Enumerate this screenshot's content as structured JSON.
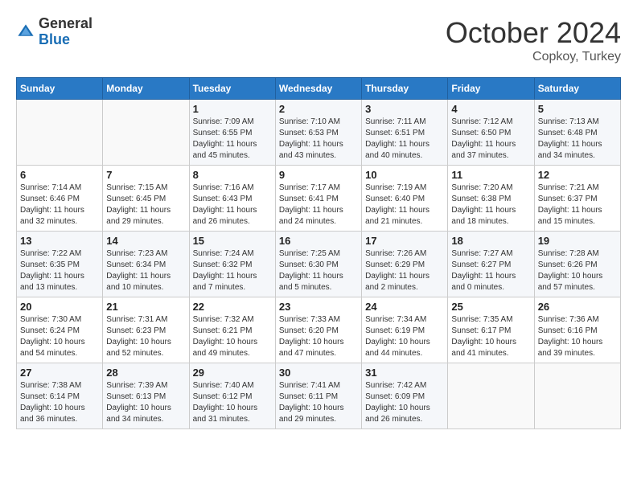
{
  "logo": {
    "general": "General",
    "blue": "Blue"
  },
  "header": {
    "month": "October 2024",
    "location": "Copkoy, Turkey"
  },
  "days_of_week": [
    "Sunday",
    "Monday",
    "Tuesday",
    "Wednesday",
    "Thursday",
    "Friday",
    "Saturday"
  ],
  "weeks": [
    [
      {
        "day": "",
        "info": ""
      },
      {
        "day": "",
        "info": ""
      },
      {
        "day": "1",
        "info": "Sunrise: 7:09 AM\nSunset: 6:55 PM\nDaylight: 11 hours and 45 minutes."
      },
      {
        "day": "2",
        "info": "Sunrise: 7:10 AM\nSunset: 6:53 PM\nDaylight: 11 hours and 43 minutes."
      },
      {
        "day": "3",
        "info": "Sunrise: 7:11 AM\nSunset: 6:51 PM\nDaylight: 11 hours and 40 minutes."
      },
      {
        "day": "4",
        "info": "Sunrise: 7:12 AM\nSunset: 6:50 PM\nDaylight: 11 hours and 37 minutes."
      },
      {
        "day": "5",
        "info": "Sunrise: 7:13 AM\nSunset: 6:48 PM\nDaylight: 11 hours and 34 minutes."
      }
    ],
    [
      {
        "day": "6",
        "info": "Sunrise: 7:14 AM\nSunset: 6:46 PM\nDaylight: 11 hours and 32 minutes."
      },
      {
        "day": "7",
        "info": "Sunrise: 7:15 AM\nSunset: 6:45 PM\nDaylight: 11 hours and 29 minutes."
      },
      {
        "day": "8",
        "info": "Sunrise: 7:16 AM\nSunset: 6:43 PM\nDaylight: 11 hours and 26 minutes."
      },
      {
        "day": "9",
        "info": "Sunrise: 7:17 AM\nSunset: 6:41 PM\nDaylight: 11 hours and 24 minutes."
      },
      {
        "day": "10",
        "info": "Sunrise: 7:19 AM\nSunset: 6:40 PM\nDaylight: 11 hours and 21 minutes."
      },
      {
        "day": "11",
        "info": "Sunrise: 7:20 AM\nSunset: 6:38 PM\nDaylight: 11 hours and 18 minutes."
      },
      {
        "day": "12",
        "info": "Sunrise: 7:21 AM\nSunset: 6:37 PM\nDaylight: 11 hours and 15 minutes."
      }
    ],
    [
      {
        "day": "13",
        "info": "Sunrise: 7:22 AM\nSunset: 6:35 PM\nDaylight: 11 hours and 13 minutes."
      },
      {
        "day": "14",
        "info": "Sunrise: 7:23 AM\nSunset: 6:34 PM\nDaylight: 11 hours and 10 minutes."
      },
      {
        "day": "15",
        "info": "Sunrise: 7:24 AM\nSunset: 6:32 PM\nDaylight: 11 hours and 7 minutes."
      },
      {
        "day": "16",
        "info": "Sunrise: 7:25 AM\nSunset: 6:30 PM\nDaylight: 11 hours and 5 minutes."
      },
      {
        "day": "17",
        "info": "Sunrise: 7:26 AM\nSunset: 6:29 PM\nDaylight: 11 hours and 2 minutes."
      },
      {
        "day": "18",
        "info": "Sunrise: 7:27 AM\nSunset: 6:27 PM\nDaylight: 11 hours and 0 minutes."
      },
      {
        "day": "19",
        "info": "Sunrise: 7:28 AM\nSunset: 6:26 PM\nDaylight: 10 hours and 57 minutes."
      }
    ],
    [
      {
        "day": "20",
        "info": "Sunrise: 7:30 AM\nSunset: 6:24 PM\nDaylight: 10 hours and 54 minutes."
      },
      {
        "day": "21",
        "info": "Sunrise: 7:31 AM\nSunset: 6:23 PM\nDaylight: 10 hours and 52 minutes."
      },
      {
        "day": "22",
        "info": "Sunrise: 7:32 AM\nSunset: 6:21 PM\nDaylight: 10 hours and 49 minutes."
      },
      {
        "day": "23",
        "info": "Sunrise: 7:33 AM\nSunset: 6:20 PM\nDaylight: 10 hours and 47 minutes."
      },
      {
        "day": "24",
        "info": "Sunrise: 7:34 AM\nSunset: 6:19 PM\nDaylight: 10 hours and 44 minutes."
      },
      {
        "day": "25",
        "info": "Sunrise: 7:35 AM\nSunset: 6:17 PM\nDaylight: 10 hours and 41 minutes."
      },
      {
        "day": "26",
        "info": "Sunrise: 7:36 AM\nSunset: 6:16 PM\nDaylight: 10 hours and 39 minutes."
      }
    ],
    [
      {
        "day": "27",
        "info": "Sunrise: 7:38 AM\nSunset: 6:14 PM\nDaylight: 10 hours and 36 minutes."
      },
      {
        "day": "28",
        "info": "Sunrise: 7:39 AM\nSunset: 6:13 PM\nDaylight: 10 hours and 34 minutes."
      },
      {
        "day": "29",
        "info": "Sunrise: 7:40 AM\nSunset: 6:12 PM\nDaylight: 10 hours and 31 minutes."
      },
      {
        "day": "30",
        "info": "Sunrise: 7:41 AM\nSunset: 6:11 PM\nDaylight: 10 hours and 29 minutes."
      },
      {
        "day": "31",
        "info": "Sunrise: 7:42 AM\nSunset: 6:09 PM\nDaylight: 10 hours and 26 minutes."
      },
      {
        "day": "",
        "info": ""
      },
      {
        "day": "",
        "info": ""
      }
    ]
  ]
}
